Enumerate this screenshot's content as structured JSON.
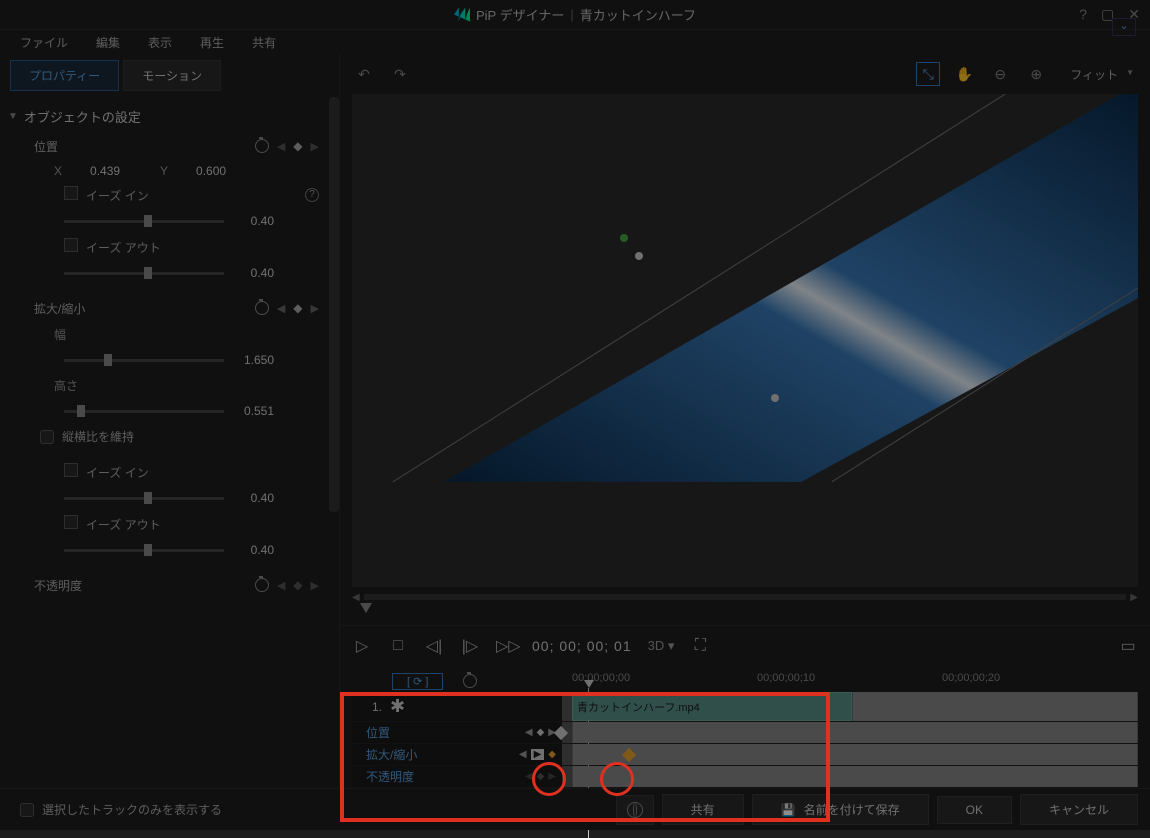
{
  "title": {
    "app": "PiP デザイナー",
    "project": "青カットインハーフ"
  },
  "menu": {
    "file": "ファイル",
    "edit": "編集",
    "view": "表示",
    "play": "再生",
    "share": "共有"
  },
  "tabs": {
    "properties": "プロパティー",
    "motion": "モーション"
  },
  "panel": {
    "object_settings": "オブジェクトの設定",
    "position": "位置",
    "x_label": "X",
    "x_val": "0.439",
    "y_label": "Y",
    "y_val": "0.600",
    "ease_in": "イーズ イン",
    "ease_in_val": "0.40",
    "ease_out": "イーズ アウト",
    "ease_out_val": "0.40",
    "scale": "拡大/縮小",
    "width": "幅",
    "width_val": "1.650",
    "height": "高さ",
    "height_val": "0.551",
    "keep_aspect": "縦横比を維持",
    "scale_ease_in_val": "0.40",
    "scale_ease_out_val": "0.40",
    "opacity": "不透明度"
  },
  "toolbar": {
    "fit": "フィット"
  },
  "playback": {
    "timecode": "00; 00; 00; 01",
    "three_d": "3D"
  },
  "timeline": {
    "ticks": [
      "00;00;00;00",
      "00;00;00;10",
      "00;00;00;20"
    ],
    "track_num": "1.",
    "clip_name": "青カットインハーフ.mp4",
    "rows": {
      "position": "位置",
      "scale": "拡大/縮小",
      "opacity": "不透明度"
    }
  },
  "footer": {
    "show_only_selected": "選択したトラックのみを表示する",
    "share": "共有",
    "save_as": "名前を付けて保存",
    "ok": "OK",
    "cancel": "キャンセル"
  }
}
